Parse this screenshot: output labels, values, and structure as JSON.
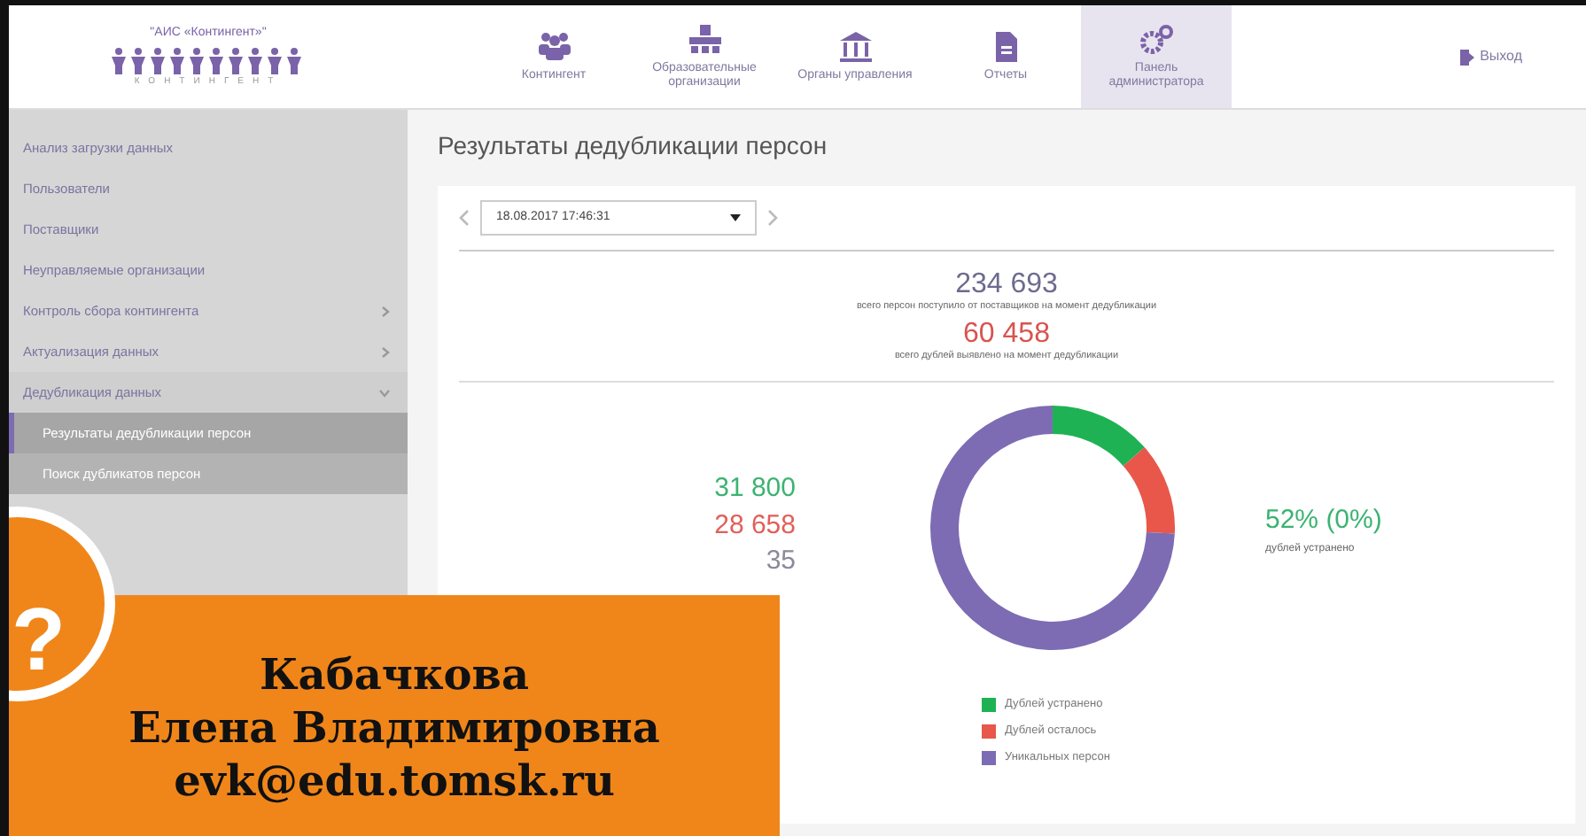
{
  "header": {
    "logo_caption": "\"АИС «Контингент»\"",
    "logo_word": "КОНТИНГЕНТ",
    "nav": [
      {
        "kind": "people",
        "label": "Контингент",
        "selected": false
      },
      {
        "kind": "buildings",
        "label": "Образовательные организации",
        "selected": false
      },
      {
        "kind": "institution",
        "label": "Органы управления",
        "selected": false
      },
      {
        "kind": "report",
        "label": "Отчеты",
        "selected": false
      },
      {
        "kind": "gears",
        "label": "Панель администратора",
        "selected": true
      }
    ],
    "logout": "Выход"
  },
  "sidebar": {
    "items": [
      {
        "label": "Анализ загрузки данных"
      },
      {
        "label": "Пользователи"
      },
      {
        "label": "Поставщики"
      },
      {
        "label": "Неуправляемые организации"
      },
      {
        "label": "Контроль сбора контингента",
        "expanded": false
      },
      {
        "label": "Актуализация данных",
        "expanded": false
      },
      {
        "label": "Дедубликация данных",
        "expanded": true,
        "children": [
          {
            "label": "Результаты дедубликации персон",
            "selected": true
          },
          {
            "label": "Поиск дубликатов персон",
            "selected": false
          }
        ]
      }
    ]
  },
  "page_title": "Результаты дедубликации персон",
  "date_select": {
    "value": "18.08.2017 17:46:31"
  },
  "totals": [
    {
      "value": "234 693",
      "caption": "всего персон поступило от поставщиков на момент дедубликации",
      "color": "#6e6a8e"
    },
    {
      "value": "60 458",
      "caption": "всего дублей выявлено на момент дедубликации",
      "color": "#d9534f"
    }
  ],
  "counts": [
    {
      "value": "31 800",
      "color": "#3cb371"
    },
    {
      "value": "28 658",
      "color": "#e0605a"
    },
    {
      "value": "35",
      "color": "#8a8a9a"
    }
  ],
  "chart_data": {
    "type": "donut",
    "categories": [
      "Дублей устранено",
      "Дублей осталось",
      "Уникальных персон"
    ],
    "values": [
      13.55,
      12.21,
      74.24
    ],
    "colors": [
      "#1fb254",
      "#e8574a",
      "#7d6bb3"
    ],
    "legend": true
  },
  "summary": {
    "value": "52% (0%)",
    "caption": "дублей устранено"
  },
  "overlay": {
    "mark": "?",
    "lines": [
      "Кабачкова",
      "Елена Владимировна",
      "evk@edu.tomsk.ru"
    ]
  }
}
